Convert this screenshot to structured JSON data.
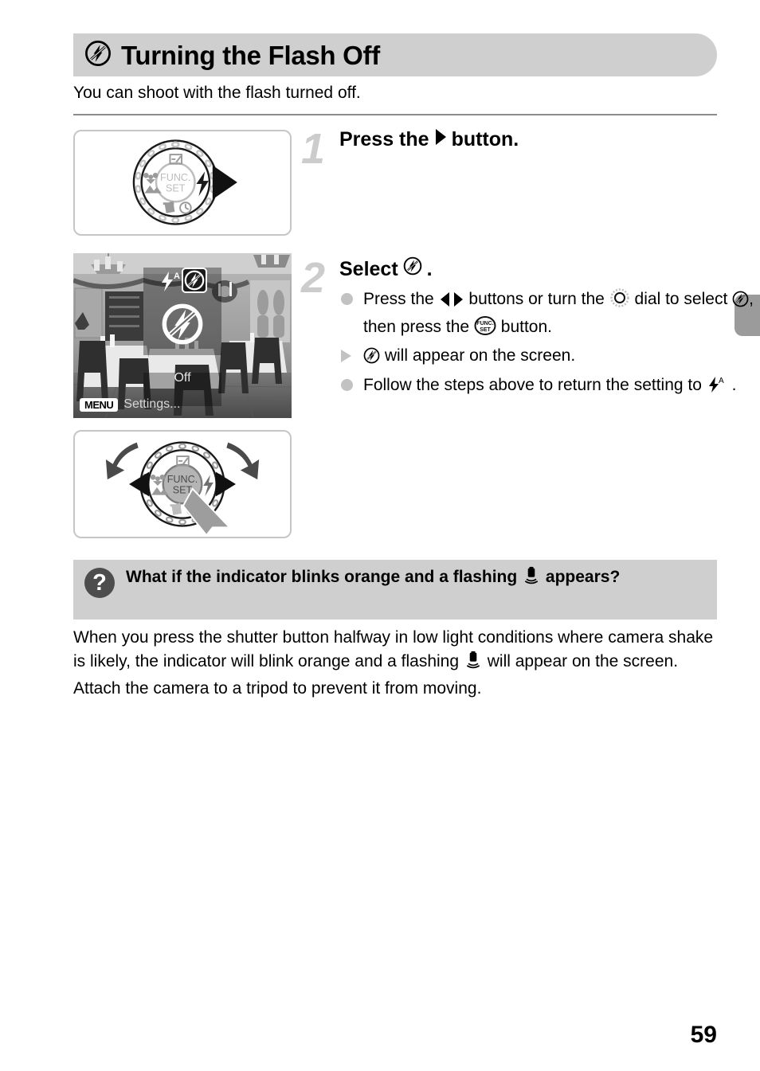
{
  "header": {
    "icon": "flash-off-icon",
    "title": "Turning the Flash Off"
  },
  "intro": "You can shoot with the flash turned off.",
  "steps": [
    {
      "number": "1",
      "heading_before": "Press the",
      "heading_icon": "right-arrow-button-icon",
      "heading_after": "button.",
      "figure": {
        "name": "control-dial-right-press",
        "center_label_line1": "FUNC.",
        "center_label_line2": "SET",
        "icons": [
          "exposure-compensation-icon",
          "macro-icon",
          "landscape-icon",
          "flash-icon",
          "delete-icon",
          "self-timer-icon"
        ]
      }
    },
    {
      "number": "2",
      "heading_before": "Select",
      "heading_icon": "flash-off-icon",
      "heading_after": ".",
      "bullets": [
        {
          "marker": "dot",
          "parts": [
            {
              "t": "text",
              "v": "Press the "
            },
            {
              "t": "icon",
              "v": "left-right-buttons-icon"
            },
            {
              "t": "text",
              "v": " buttons or turn the "
            },
            {
              "t": "icon",
              "v": "control-dial-icon"
            },
            {
              "t": "text",
              "v": " dial to select "
            },
            {
              "t": "icon",
              "v": "flash-off-icon"
            },
            {
              "t": "text",
              "v": ", then press the "
            },
            {
              "t": "icon",
              "v": "func-set-button-icon"
            },
            {
              "t": "text",
              "v": " button."
            }
          ],
          "plain": "Press the ◀▶ buttons or turn the ◎ dial to select (flash off), then press the FUNC./SET button."
        },
        {
          "marker": "triangle",
          "parts": [
            {
              "t": "icon",
              "v": "flash-off-icon"
            },
            {
              "t": "text",
              "v": " will appear on the screen."
            }
          ],
          "plain": "(flash off) will appear on the screen."
        },
        {
          "marker": "dot",
          "parts": [
            {
              "t": "text",
              "v": "Follow the steps above to return the setting to "
            },
            {
              "t": "icon",
              "v": "flash-auto-icon"
            },
            {
              "t": "text",
              "v": " ."
            }
          ],
          "plain": "Follow the steps above to return the setting to (flash auto)."
        }
      ]
    }
  ],
  "screenshot": {
    "name": "camera-lcd-flash-menu",
    "flash_auto_label": "A",
    "selected_option": "flash-off-icon",
    "mode_label": "Off",
    "menu_badge": "MENU",
    "menu_hint": "Settings..."
  },
  "figure_dial_turn": {
    "name": "control-dial-turn-and-press",
    "center_label_line1": "FUNC.",
    "center_label_line2": "SET"
  },
  "qa": {
    "icon": "question-mark-icon",
    "icon_glyph": "?",
    "title_before": "What if the indicator blinks orange and a flashing",
    "title_icon": "camera-shake-warning-icon",
    "title_after": "appears?",
    "body_before": "When you press the shutter button halfway in low light conditions where camera shake is likely, the indicator will blink orange and a flashing",
    "body_icon": "camera-shake-warning-icon",
    "body_after": "will appear on the screen. Attach the camera to a tripod to prevent it from moving."
  },
  "page_number": "59",
  "colors": {
    "band": "#cfcfcf",
    "step_number": "#cccccc",
    "rule": "#8c8c8c",
    "marker": "#c2c2c2",
    "qa_icon": "#4d4d4d",
    "edge_tab": "#9b9b9b"
  }
}
